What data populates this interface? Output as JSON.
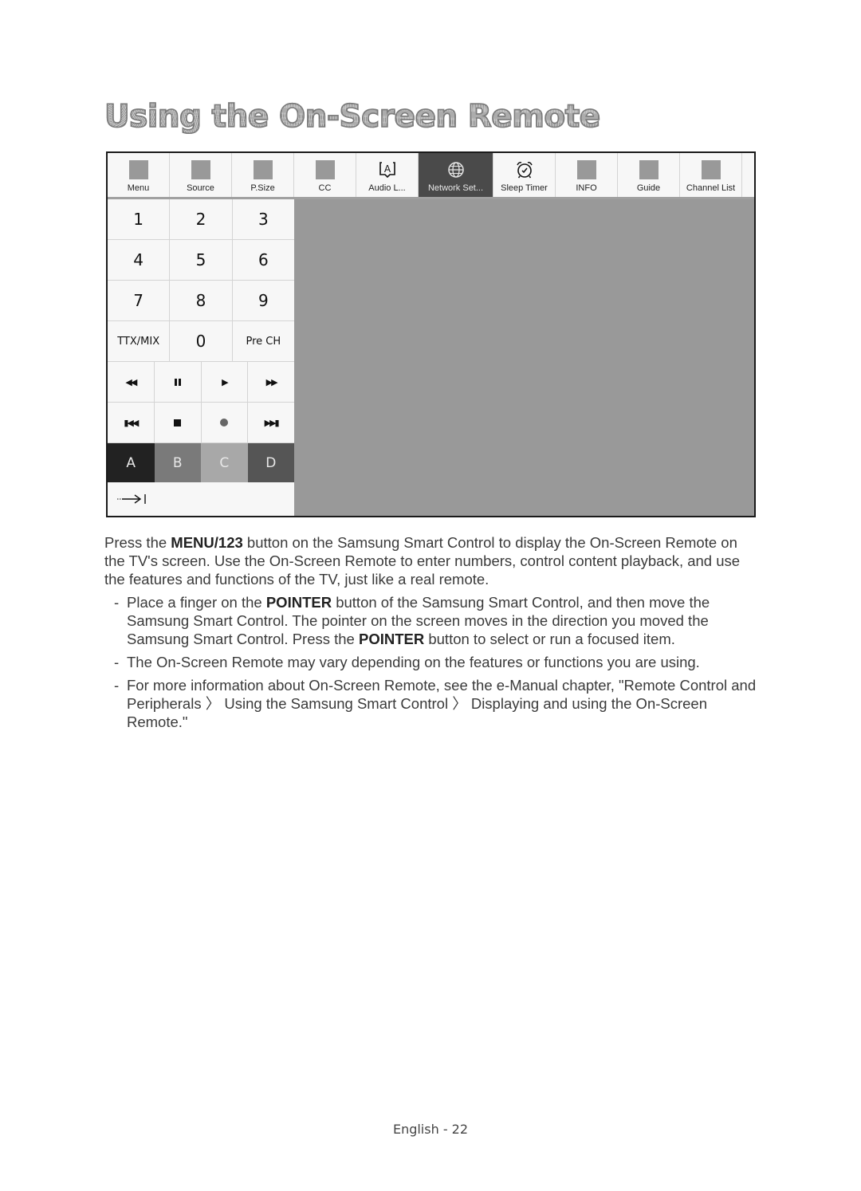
{
  "page": {
    "title": "Using the On-Screen Remote",
    "footer": "English - 22"
  },
  "remote": {
    "toolbar": [
      {
        "label": "Menu",
        "icon": "placeholder-square"
      },
      {
        "label": "Source",
        "icon": "placeholder-square"
      },
      {
        "label": "P.Size",
        "icon": "placeholder-square"
      },
      {
        "label": "CC",
        "icon": "placeholder-square"
      },
      {
        "label": "Audio L...",
        "icon": "audio-language-icon"
      },
      {
        "label": "Network Set...",
        "icon": "globe-icon",
        "active": true
      },
      {
        "label": "Sleep Timer",
        "icon": "alarm-clock-icon"
      },
      {
        "label": "INFO",
        "icon": "placeholder-square"
      },
      {
        "label": "Guide",
        "icon": "placeholder-square"
      },
      {
        "label": "Channel List",
        "icon": "placeholder-square"
      }
    ],
    "keypad": {
      "rows": [
        [
          "1",
          "2",
          "3"
        ],
        [
          "4",
          "5",
          "6"
        ],
        [
          "7",
          "8",
          "9"
        ],
        [
          "TTX/MIX",
          "0",
          "Pre CH"
        ]
      ],
      "media_row_1": [
        "rewind",
        "pause",
        "play",
        "fast-forward"
      ],
      "media_row_2": [
        "previous",
        "stop",
        "record",
        "next"
      ],
      "color_buttons": [
        "A",
        "B",
        "C",
        "D"
      ],
      "color_hex": {
        "A": "#222222",
        "B": "#7a7a7a",
        "C": "#a8a8a8",
        "D": "#555555"
      },
      "tab_key": "tab-arrow"
    },
    "colors": {
      "active_tab": "#4a4a4a",
      "screen_area": "#999999",
      "panel_bg": "#f7f7f7"
    }
  },
  "body": {
    "intro": {
      "pre": "Press the ",
      "bold": "MENU/123",
      "post": " button on the Samsung Smart Control to display the On-Screen Remote on the TV's screen. Use the On-Screen Remote to enter numbers, control content playback, and use the features and functions of the TV, just like a real remote."
    },
    "bullets": [
      {
        "dash": "-",
        "p1": "Place a finger on the ",
        "b1": "POINTER",
        "p2": " button of the Samsung Smart Control, and then move the Samsung Smart Control. The pointer on the screen moves in the direction you moved the Samsung Smart Control. Press the ",
        "b2": "POINTER",
        "p3": " button to select or run a focused item."
      },
      {
        "dash": "-",
        "text": "The On-Screen Remote may vary depending on the features or functions you are using."
      },
      {
        "dash": "-",
        "text": "For more information about On-Screen Remote, see the e-Manual chapter, \"Remote Control and Peripherals 〉 Using the Samsung Smart Control 〉 Displaying and using the On-Screen Remote.\""
      }
    ]
  }
}
